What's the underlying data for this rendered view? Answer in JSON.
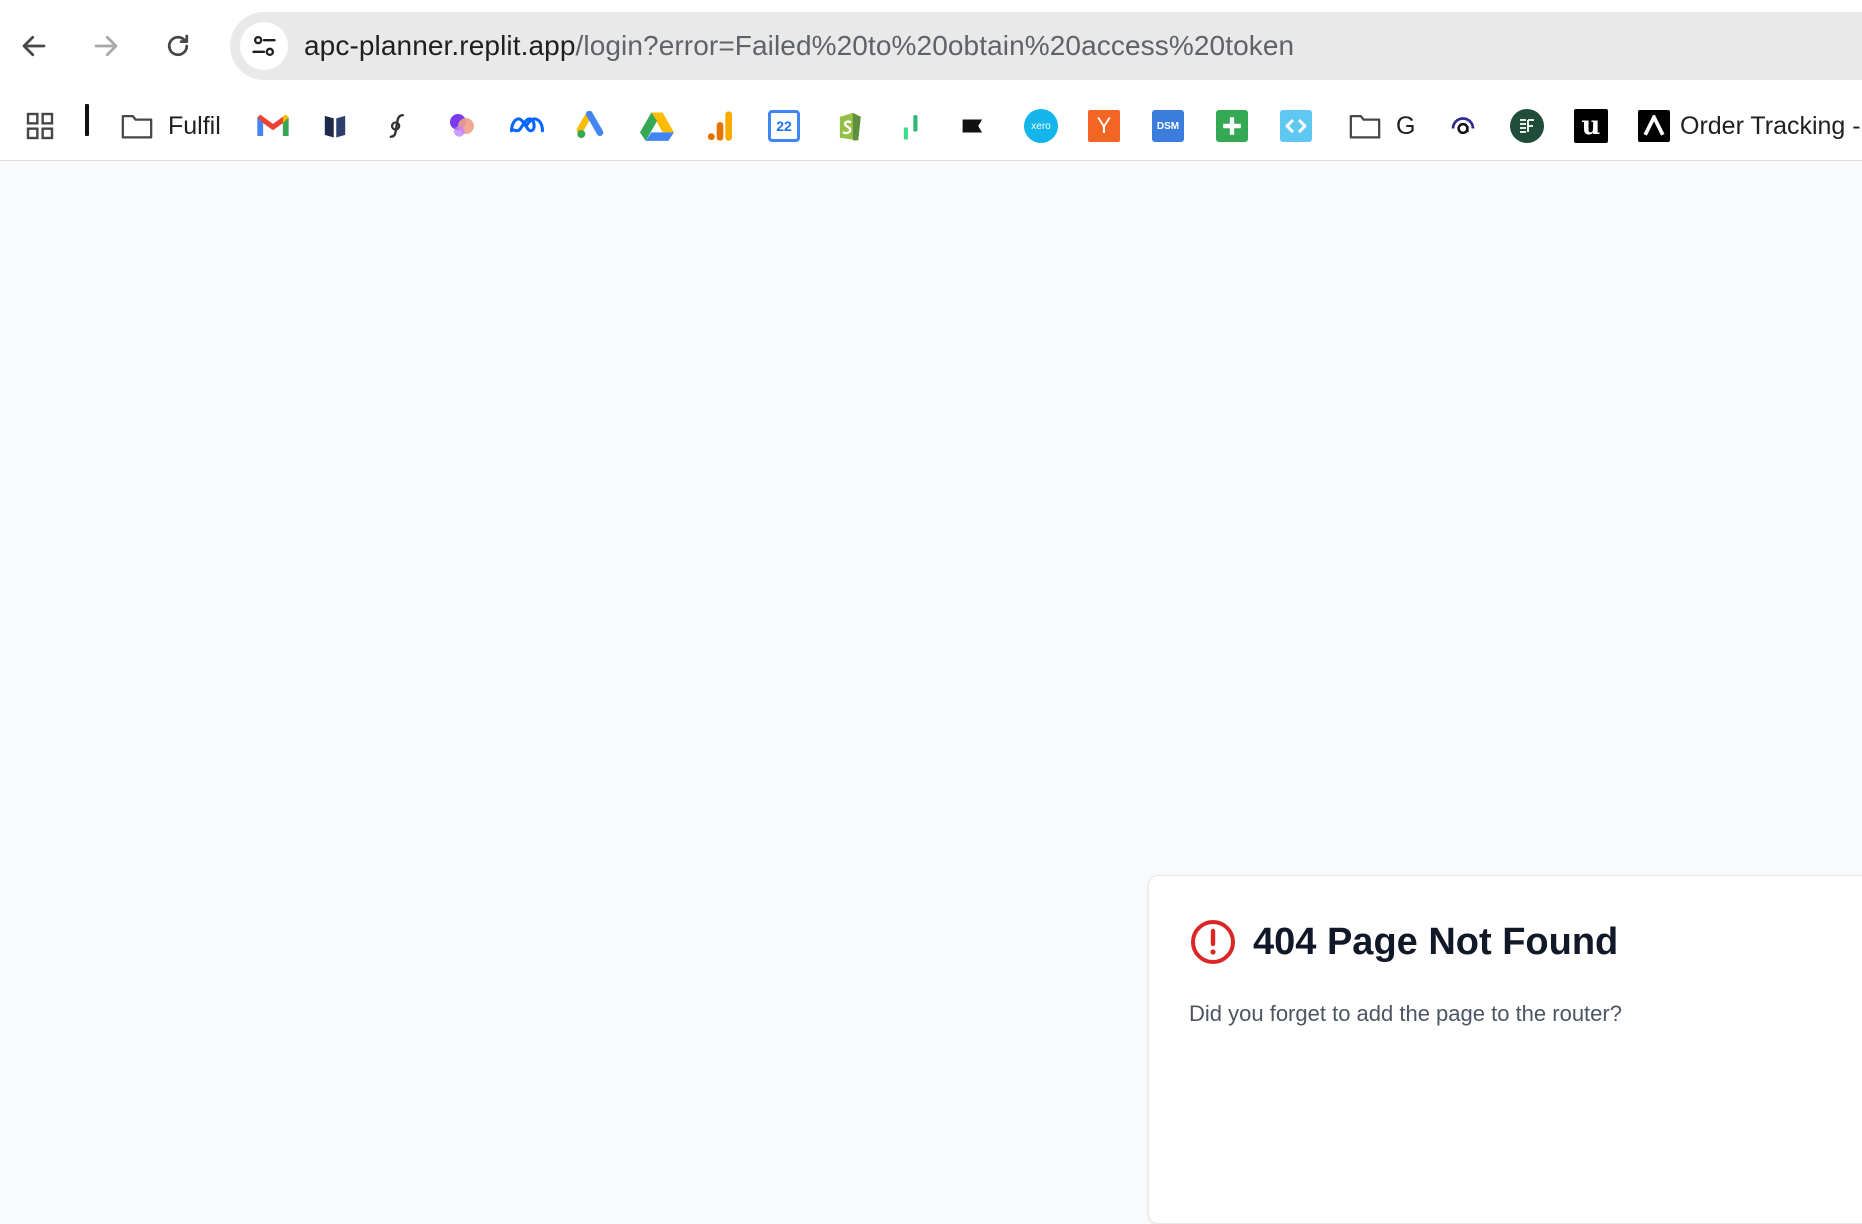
{
  "browser": {
    "url_host": "apc-planner.replit.app",
    "url_path": "/login?error=Failed%20to%20obtain%20access%20token"
  },
  "bookmarks": {
    "folder_fulfil": "Fulfil",
    "folder_g": "G",
    "order_tracking": "Order Tracking -",
    "calendar_day": "22",
    "xero_text": "xero",
    "y_text": "Y",
    "dsm_text": "DSM",
    "u_text": "u"
  },
  "error": {
    "title": "404 Page Not Found",
    "message": "Did you forget to add the page to the router?"
  },
  "colors": {
    "error_red": "#dc2626",
    "page_bg": "#f9fafb",
    "card_title": "#111827",
    "card_text": "#4b5563"
  }
}
